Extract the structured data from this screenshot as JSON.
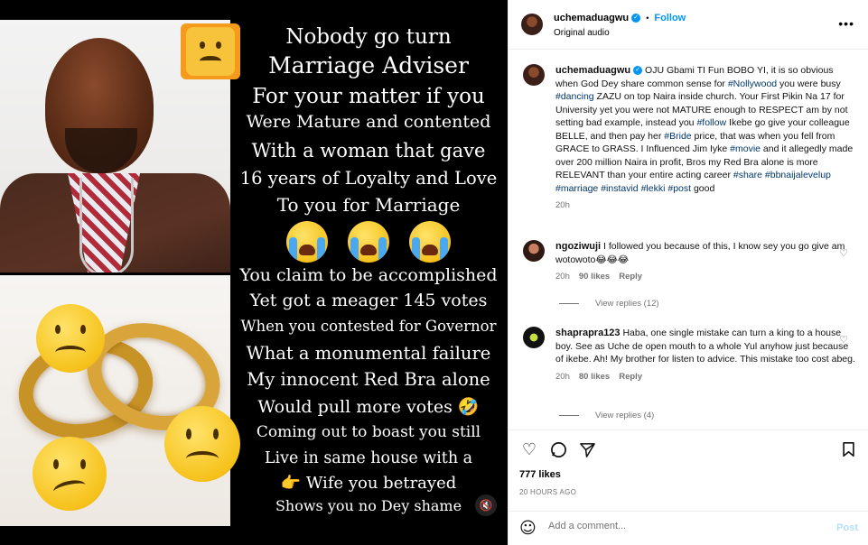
{
  "media": {
    "poem_lines": [
      "Nobody go turn",
      "Marriage Adviser",
      "For your matter if you",
      "Were Mature and contented",
      "With a woman that gave",
      "16 years of Loyalty and Love",
      "To you for Marriage"
    ],
    "poem_lines_2": [
      "You claim to be accomplished",
      "Yet got a meager 145 votes",
      "When you contested for Governor",
      "What a monumental failure",
      "My innocent Red Bra alone",
      "Would pull more votes",
      "Coming out to boast you still",
      "Live in same house with a",
      "Wife you betrayed",
      "Shows you no Dey shame"
    ],
    "laugh_emoji": "🤣",
    "point_emoji": "👉",
    "mute_icon": "🔇"
  },
  "header": {
    "username": "uchemaduagwu",
    "verified": "✓",
    "dot": "•",
    "follow": "Follow",
    "audio": "Original audio",
    "more": "•••"
  },
  "caption": {
    "username": "uchemaduagwu",
    "text_parts": [
      " OJU Gbami TI Fun BOBO YI, it is so obvious when God Dey share common sense for ",
      "#Nollywood",
      " you were busy ",
      "#dancing",
      " ZAZU on top Naira inside church. Your First Pikin Na 17 for University yet you were not MATURE enough to RESPECT am by not setting bad example, instead you ",
      "#follow",
      " Ikebe go give your colleague BELLE, and then pay her ",
      "#Bride",
      " price, that was when you fell from GRACE to GRASS. I Influenced Jim Iyke ",
      "#movie",
      " and it allegedly made over 200 million Naira in profit, Bros my Red Bra alone is more RELEVANT than your entire acting career ",
      "#share",
      " ",
      "#bbnaijalevelup",
      " ",
      "#marriage",
      " ",
      "#instavid",
      " ",
      "#lekki",
      " ",
      "#post",
      " good"
    ],
    "time": "20h"
  },
  "comments": [
    {
      "username": "ngoziwuji",
      "text": " I followed you because of this, I know sey you go give am wotowoto😂😂😂",
      "time": "20h",
      "likes": "90 likes",
      "reply": "Reply",
      "view_replies": "View replies (12)"
    },
    {
      "username": "shaprapra123",
      "text": " Haba, one single mistake can turn a king to a house boy. See as Uche de open mouth to a whole Yul anyhow just because of ikebe. Ah! My brother for listen to advice. This mistake too cost abeg.",
      "time": "20h",
      "likes": "80 likes",
      "reply": "Reply",
      "view_replies": "View replies (4)"
    }
  ],
  "actions": {
    "likes": "777 likes",
    "ago": "20 HOURS AGO"
  },
  "add_comment": {
    "placeholder": "Add a comment...",
    "post": "Post"
  },
  "colors": {
    "accent": "#0095f6",
    "hashtag": "#00376b",
    "muted": "#737373"
  }
}
